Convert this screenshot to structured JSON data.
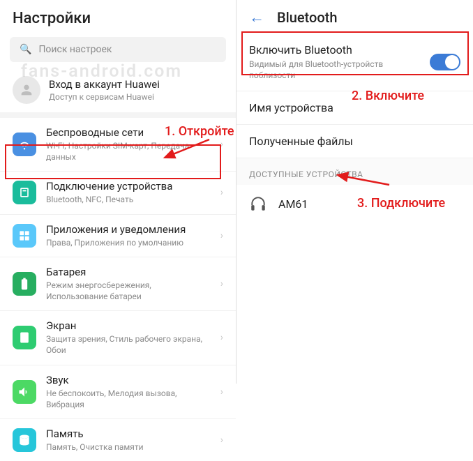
{
  "left": {
    "title": "Настройки",
    "search_placeholder": "Поиск настроек",
    "account": {
      "title": "Вход в аккаунт Huawei",
      "sub": "Доступ к сервисам Huawei"
    },
    "items": [
      {
        "title": "Беспроводные сети",
        "sub": "Wi-Fi, Настройки SIM-карт, Передача данных"
      },
      {
        "title": "Подключение устройства",
        "sub": "Bluetooth, NFC, Печать"
      },
      {
        "title": "Приложения и уведомления",
        "sub": "Права, Приложения по умолчанию"
      },
      {
        "title": "Батарея",
        "sub": "Режим энергосбережения, Использование батареи"
      },
      {
        "title": "Экран",
        "sub": "Защита зрения, Стиль рабочего экрана, Обои"
      },
      {
        "title": "Звук",
        "sub": "Не беспокоить, Мелодия вызова, Вибрация"
      },
      {
        "title": "Память",
        "sub": "Память, Очистка памяти"
      }
    ]
  },
  "right": {
    "title": "Bluetooth",
    "enable": {
      "title": "Включить Bluetooth",
      "sub": "Видимый для Bluetooth-устройств поблизости"
    },
    "device_name_label": "Имя устройства",
    "received_label": "Полученные файлы",
    "available_label": "ДОСТУПНЫЕ УСТРОЙСТВА",
    "devices": [
      {
        "name": "AM61"
      }
    ]
  },
  "annotations": {
    "step1": "1. Откройте",
    "step2": "2. Включите",
    "step3": "3. Подключите",
    "watermark": "fans-android.com"
  }
}
